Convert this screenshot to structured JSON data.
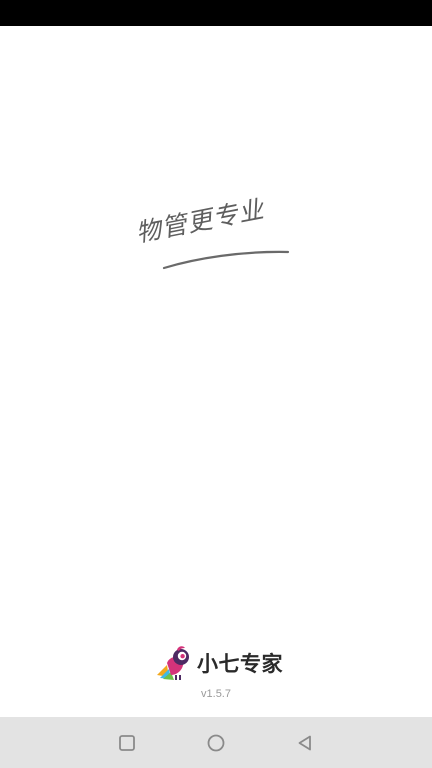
{
  "splash": {
    "slogan": "物管更专业",
    "brand_name": "小七专家",
    "version": "v1.5.7"
  },
  "colors": {
    "status_bar": "#000000",
    "background": "#ffffff",
    "nav_bar": "#e3e3e3",
    "nav_icon": "#8a8a8a",
    "slogan": "#5e5e5e",
    "brand_text": "#2a2a2a",
    "version_text": "#9a9a9a",
    "logo_pink": "#d4337a",
    "logo_purple": "#4d2a63"
  },
  "icons": {
    "logo": "bird-logo-icon",
    "recents": "square-recents-icon",
    "home": "circle-home-icon",
    "back": "triangle-back-icon"
  }
}
